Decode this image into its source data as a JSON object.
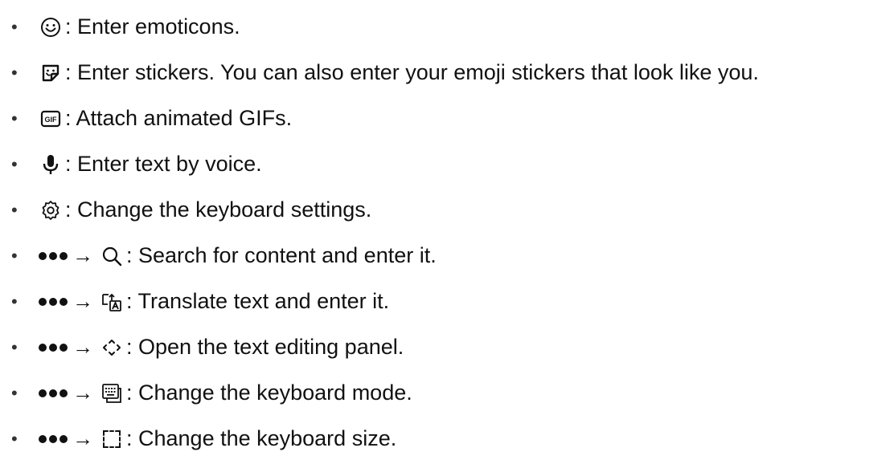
{
  "items": [
    {
      "icon": "emoticon-icon",
      "has_more": false,
      "text": ": Enter emoticons."
    },
    {
      "icon": "sticker-icon",
      "has_more": false,
      "text": ": Enter stickers. You can also enter your emoji stickers that look like you."
    },
    {
      "icon": "gif-icon",
      "has_more": false,
      "text": ": Attach animated GIFs."
    },
    {
      "icon": "microphone-icon",
      "has_more": false,
      "text": ": Enter text by voice."
    },
    {
      "icon": "gear-icon",
      "has_more": false,
      "text": ": Change the keyboard settings."
    },
    {
      "icon": "search-icon",
      "has_more": true,
      "text": ": Search for content and enter it."
    },
    {
      "icon": "translate-icon",
      "has_more": true,
      "text": ": Translate text and enter it."
    },
    {
      "icon": "text-editing-icon",
      "has_more": true,
      "text": ": Open the text editing panel."
    },
    {
      "icon": "keyboard-mode-icon",
      "has_more": true,
      "text": ": Change the keyboard mode."
    },
    {
      "icon": "keyboard-size-icon",
      "has_more": true,
      "text": ": Change the keyboard size."
    }
  ],
  "symbols": {
    "bullet": "•",
    "arrow": "→"
  },
  "gif_icon_label": "GIF"
}
